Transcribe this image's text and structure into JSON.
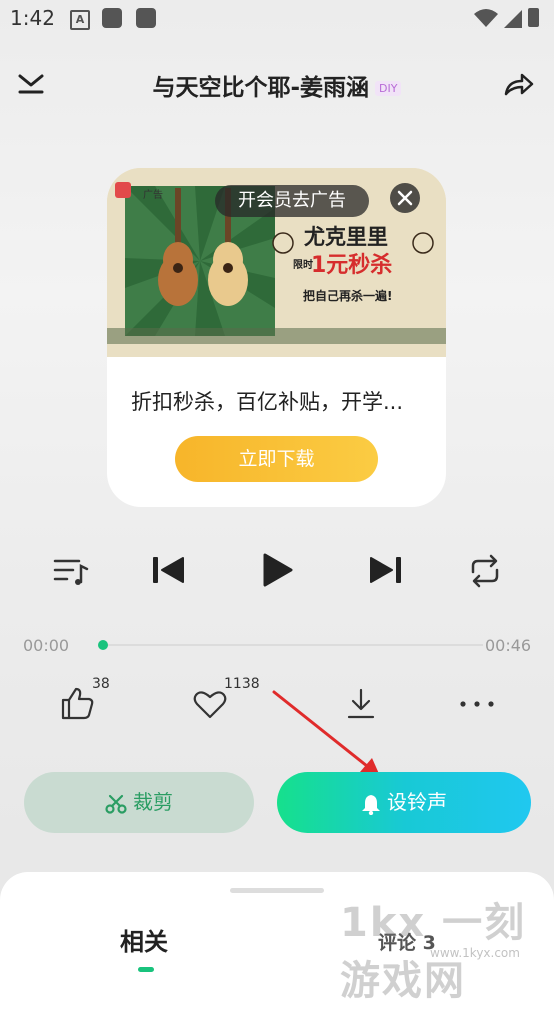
{
  "status_bar": {
    "time": "1:42",
    "a_label": "A"
  },
  "header": {
    "title": "与天空比个耶-姜雨涵",
    "badge": "DIY"
  },
  "ad": {
    "vip_label": "开会员去广告",
    "ad_tag": "广告",
    "headline_1": "尤克里里",
    "headline_2": "1元秒杀",
    "limit_label": "限时",
    "slogan": "把自己再杀一遍!",
    "description": "折扣秒杀，百亿补贴，开学...",
    "download_label": "立即下载"
  },
  "player": {
    "current_time": "00:00",
    "total_time": "00:46",
    "progress": 0.0
  },
  "actions": {
    "like_count": "38",
    "favorite_count": "1138"
  },
  "buttons": {
    "cut_label": "裁剪",
    "ringtone_label": "设铃声"
  },
  "tabs": {
    "related": "相关",
    "comments": "评论 3"
  },
  "watermark": {
    "text": "1kx 一刻游戏网",
    "url": "www.1kyx.com"
  },
  "colors": {
    "accent_green": "#19c37d",
    "ringtone_gradient_end": "#20c8f0",
    "download_orange": "#f7b52a"
  }
}
